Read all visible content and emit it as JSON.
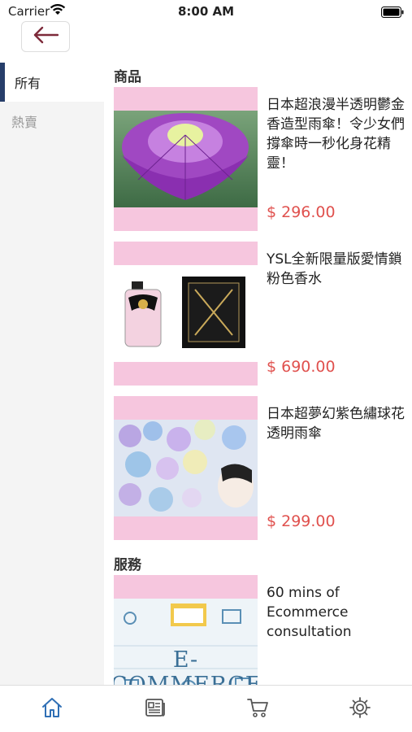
{
  "status": {
    "carrier": "Carrier",
    "time": "8:00 AM"
  },
  "sidebar": {
    "items": [
      {
        "label": "所有"
      },
      {
        "label": "熱賣"
      }
    ]
  },
  "sections": [
    {
      "title": "商品"
    },
    {
      "title": "服務"
    }
  ],
  "products": [
    {
      "title": "日本超浪漫半透明鬱金香造型雨傘！令少女們撐傘時一秒化身花精靈！",
      "price": "$ 296.00"
    },
    {
      "title": "YSL全新限量版愛情鎖粉色香水",
      "price": "$ 690.00"
    },
    {
      "title": "日本超夢幻紫色繡球花透明雨傘",
      "price": "$ 299.00"
    }
  ],
  "services": [
    {
      "title": "60 mins of Ecommerce consultation",
      "image_text": "E-COMMERCE"
    }
  ],
  "tabbar": {
    "icons": [
      "home-icon",
      "news-icon",
      "cart-icon",
      "settings-icon"
    ]
  },
  "colors": {
    "accent": "#2f6fb5",
    "price": "#e0514e",
    "image_bg": "#f6c6de",
    "sidebar_active": "#273e6a"
  }
}
